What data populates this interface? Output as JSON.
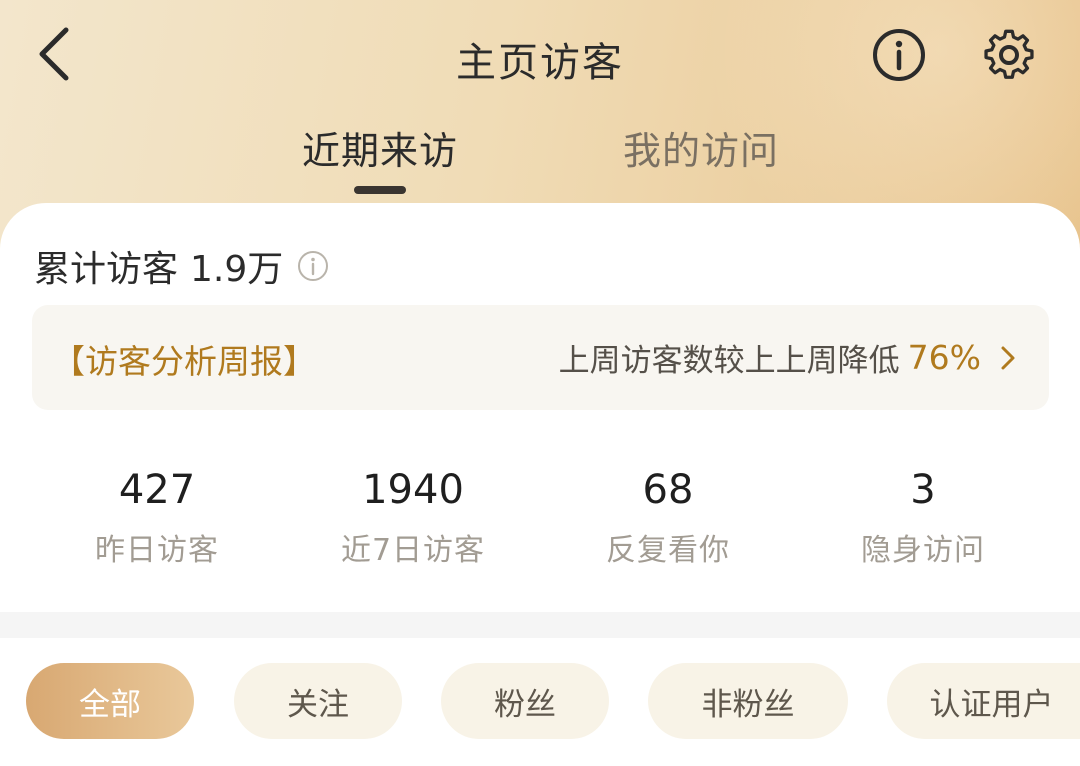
{
  "header": {
    "title": "主页访客",
    "tabs": [
      {
        "label": "近期来访",
        "active": true
      },
      {
        "label": "我的访问",
        "active": false
      }
    ]
  },
  "summary": {
    "total_label": "累计访客",
    "total_value": "1.9万"
  },
  "report": {
    "title": "【访客分析周报】",
    "description": "上周访客数较上上周降低",
    "percent": "76%"
  },
  "stats": [
    {
      "value": "427",
      "label": "昨日访客"
    },
    {
      "value": "1940",
      "label": "近7日访客"
    },
    {
      "value": "68",
      "label": "反复看你"
    },
    {
      "value": "3",
      "label": "隐身访问"
    }
  ],
  "filters": [
    {
      "label": "全部",
      "active": true
    },
    {
      "label": "关注",
      "active": false
    },
    {
      "label": "粉丝",
      "active": false
    },
    {
      "label": "非粉丝",
      "active": false
    },
    {
      "label": "认证用户",
      "active": false
    }
  ],
  "icons": {
    "back": "chevron-left-icon",
    "info": "info-circle-icon",
    "settings": "gear-icon",
    "report_arrow": "chevron-right-icon"
  },
  "colors": {
    "accent": "#b07a1e",
    "header_gradient_start": "#f3e6cc",
    "header_gradient_end": "#e8c48e",
    "chip_active_start": "#d8a872",
    "chip_active_end": "#e9c89a",
    "chip_inactive": "#f8f3e7"
  }
}
